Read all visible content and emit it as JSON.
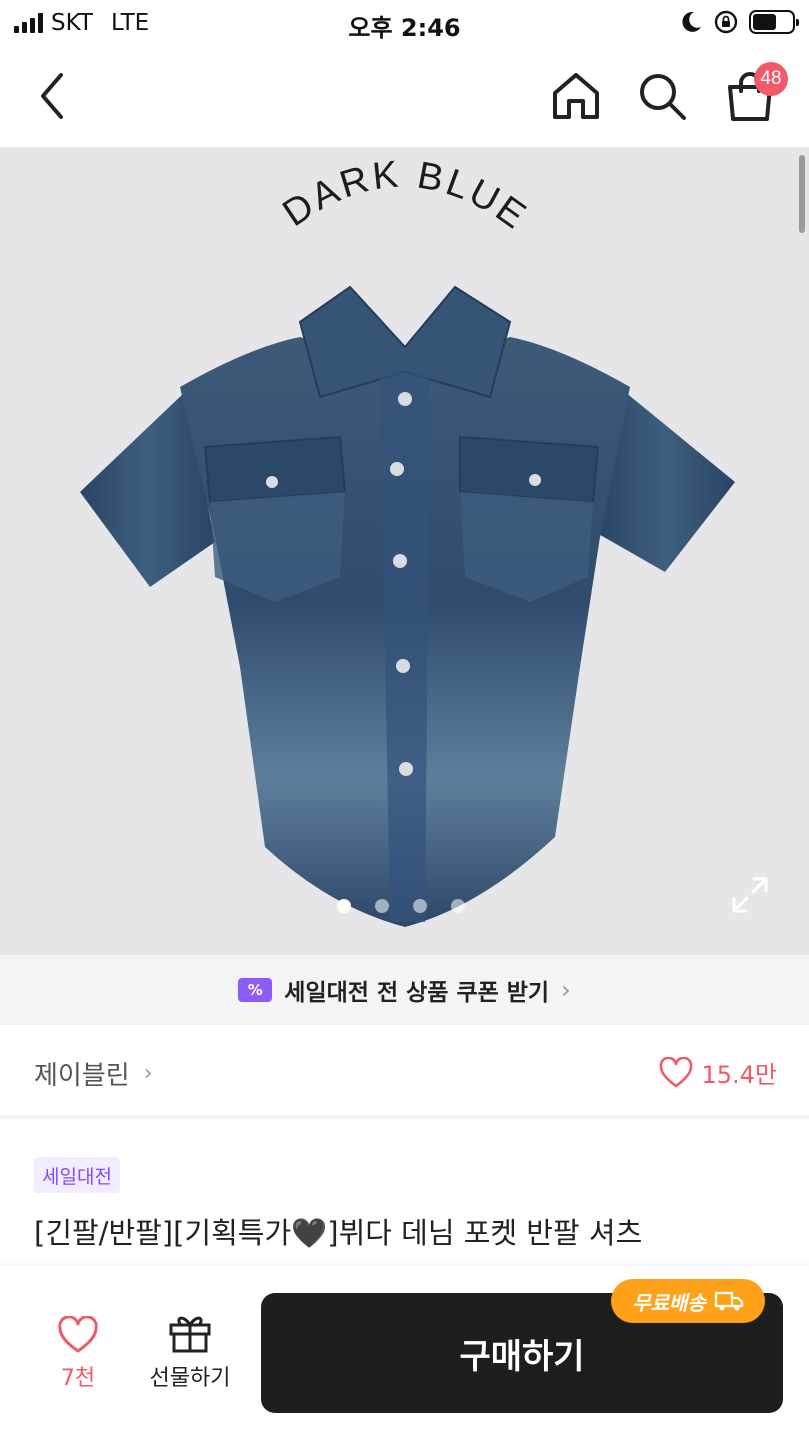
{
  "status_bar": {
    "carrier": "SKT",
    "network": "LTE",
    "time": "오후 2:46"
  },
  "nav": {
    "cart_count": "48",
    "icons": [
      "back-arrow-icon",
      "home-icon",
      "search-icon",
      "shopping-bag-icon"
    ]
  },
  "product_image": {
    "caption": "DARK BLUE",
    "slide_count": 4,
    "active_slide": 1
  },
  "coupon_banner": {
    "icon_text": "%",
    "text": "세일대전 전 상품 쿠폰 받기"
  },
  "brand": {
    "name": "제이블린",
    "like_count": "15.4만"
  },
  "product": {
    "tag": "세일대전",
    "title": "[긴팔/반팔][기획특가🖤]뷔다 데님 포켓 반팔 셔츠"
  },
  "bottom_bar": {
    "wish_count": "7천",
    "gift_label": "선물하기",
    "buy_label": "구매하기",
    "free_shipping_label": "무료배송"
  },
  "colors": {
    "accent_red": "#f05a6a",
    "coupon_purple": "#8b5cf6",
    "buy_button": "#1e1e1e",
    "shipping_orange": "#ffa21a",
    "image_background": "#e6e6e8"
  }
}
